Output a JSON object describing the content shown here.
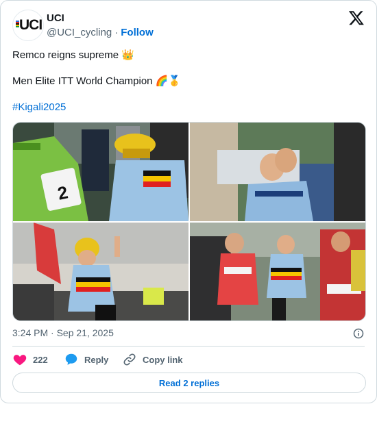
{
  "account": {
    "name": "UCI",
    "handle": "@UCI_cycling",
    "separator": "·",
    "follow_label": "Follow",
    "avatar_text": "UCI"
  },
  "tweet": {
    "line1": "Remco reigns supreme 👑",
    "line2": "Men Elite ITT World Champion 🌈🥇",
    "hashtag": "#Kigali2025"
  },
  "media": [
    {
      "icon": "photo-rider-with-helmet-icon",
      "bib_number": "2"
    },
    {
      "icon": "photo-embrace-icon"
    },
    {
      "icon": "photo-rider-celebrating-icon"
    },
    {
      "icon": "photo-rider-crowd-icon"
    }
  ],
  "meta": {
    "timestamp": "3:24 PM · Sep 21, 2025"
  },
  "actions": {
    "like_count": "222",
    "reply_label": "Reply",
    "copy_label": "Copy link"
  },
  "read_replies_label": "Read 2 replies",
  "colors": {
    "link": "#006fd6",
    "heart": "#f91880",
    "reply_bubble": "#1d9bf0",
    "muted": "#536471",
    "border": "#cfd9de"
  }
}
